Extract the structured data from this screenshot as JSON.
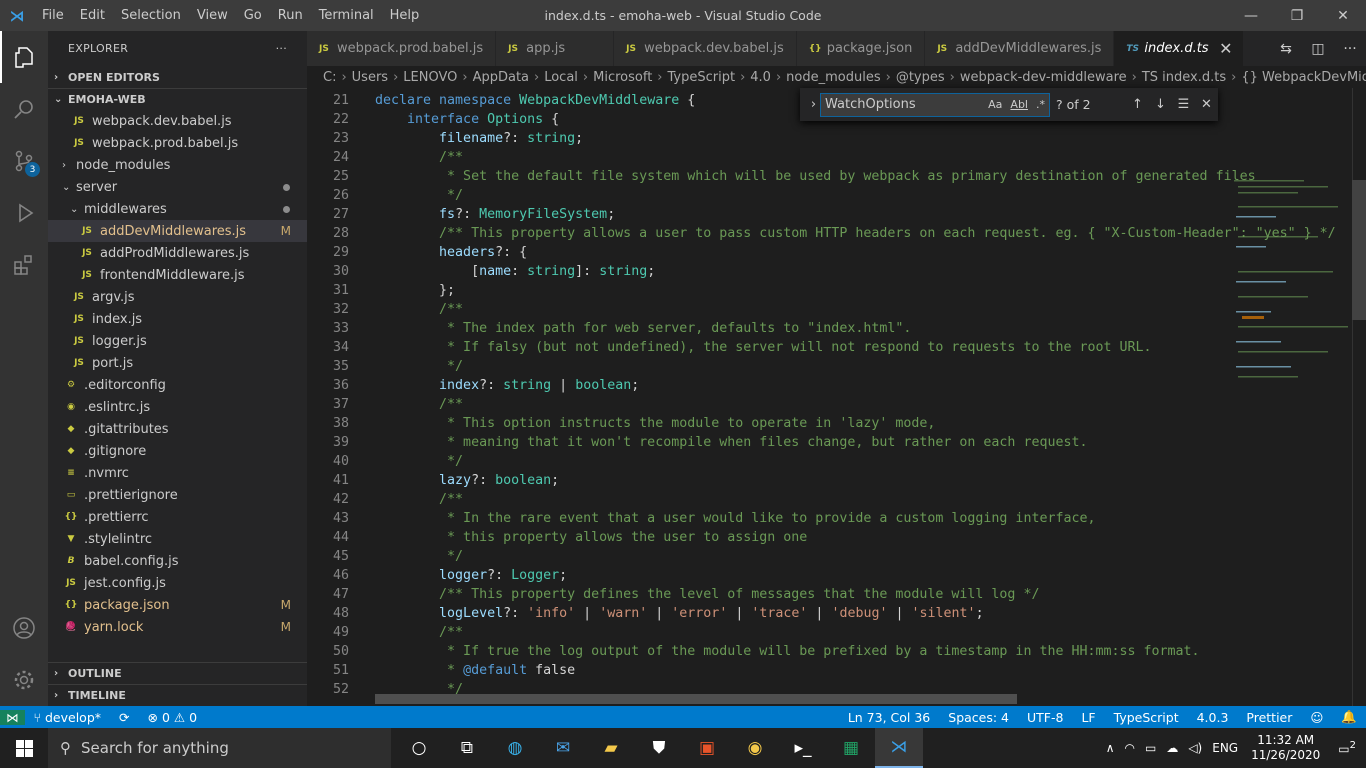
{
  "window": {
    "app_menu": [
      "File",
      "Edit",
      "Selection",
      "View",
      "Go",
      "Run",
      "Terminal",
      "Help"
    ],
    "title": "index.d.ts - emoha-web - Visual Studio Code"
  },
  "activity": {
    "scm_badge": "3"
  },
  "explorer": {
    "header": "EXPLORER",
    "more": "···",
    "open_editors": "OPEN EDITORS",
    "project": "EMOHA-WEB",
    "outline": "OUTLINE",
    "timeline": "TIMELINE",
    "items": [
      {
        "name": "webpack.dev.babel.js",
        "icon": "JS",
        "depth": 2,
        "kind": "file"
      },
      {
        "name": "webpack.prod.babel.js",
        "icon": "JS",
        "depth": 2,
        "kind": "file"
      },
      {
        "name": "node_modules",
        "icon": "",
        "depth": 1,
        "kind": "folder-closed"
      },
      {
        "name": "server",
        "icon": "",
        "depth": 1,
        "kind": "folder-open",
        "dot": true
      },
      {
        "name": "middlewares",
        "icon": "",
        "depth": 2,
        "kind": "folder-open",
        "dot": true
      },
      {
        "name": "addDevMiddlewares.js",
        "icon": "JS",
        "depth": 3,
        "kind": "file",
        "tag": "M",
        "selected": true
      },
      {
        "name": "addProdMiddlewares.js",
        "icon": "JS",
        "depth": 3,
        "kind": "file"
      },
      {
        "name": "frontendMiddleware.js",
        "icon": "JS",
        "depth": 3,
        "kind": "file"
      },
      {
        "name": "argv.js",
        "icon": "JS",
        "depth": 2,
        "kind": "file"
      },
      {
        "name": "index.js",
        "icon": "JS",
        "depth": 2,
        "kind": "file"
      },
      {
        "name": "logger.js",
        "icon": "JS",
        "depth": 2,
        "kind": "file"
      },
      {
        "name": "port.js",
        "icon": "JS",
        "depth": 2,
        "kind": "file"
      },
      {
        "name": ".editorconfig",
        "icon": "⚙",
        "depth": 1,
        "kind": "file"
      },
      {
        "name": ".eslintrc.js",
        "icon": "◉",
        "depth": 1,
        "kind": "file"
      },
      {
        "name": ".gitattributes",
        "icon": "◆",
        "depth": 1,
        "kind": "file"
      },
      {
        "name": ".gitignore",
        "icon": "◆",
        "depth": 1,
        "kind": "file"
      },
      {
        "name": ".nvmrc",
        "icon": "≡",
        "depth": 1,
        "kind": "file"
      },
      {
        "name": ".prettierignore",
        "icon": "▭",
        "depth": 1,
        "kind": "file"
      },
      {
        "name": ".prettierrc",
        "icon": "{}",
        "depth": 1,
        "kind": "file"
      },
      {
        "name": ".stylelintrc",
        "icon": "▼",
        "depth": 1,
        "kind": "file"
      },
      {
        "name": "babel.config.js",
        "icon": "𝘽",
        "depth": 1,
        "kind": "file"
      },
      {
        "name": "jest.config.js",
        "icon": "JS",
        "depth": 1,
        "kind": "file"
      },
      {
        "name": "package.json",
        "icon": "{}",
        "depth": 1,
        "kind": "file",
        "tag": "M"
      },
      {
        "name": "yarn.lock",
        "icon": "🧶",
        "depth": 1,
        "kind": "file",
        "tag": "M"
      }
    ]
  },
  "tabs": [
    {
      "label": "webpack.prod.babel.js",
      "icon": "JS"
    },
    {
      "label": "app.js",
      "icon": "JS"
    },
    {
      "label": "webpack.dev.babel.js",
      "icon": "JS"
    },
    {
      "label": "package.json",
      "icon": "{}"
    },
    {
      "label": "addDevMiddlewares.js",
      "icon": "JS"
    },
    {
      "label": "index.d.ts",
      "icon": "TS",
      "active": true
    }
  ],
  "breadcrumbs": [
    "C:",
    "Users",
    "LENOVO",
    "AppData",
    "Local",
    "Microsoft",
    "TypeScript",
    "4.0",
    "node_modules",
    "@types",
    "webpack-dev-middleware",
    "TS index.d.ts",
    "{} WebpackDevMiddleware"
  ],
  "find": {
    "value": "WatchOptions",
    "options": [
      "Aa",
      "Abl",
      ".*"
    ],
    "count": "? of 2"
  },
  "code_lines": [
    {
      "n": "21",
      "t": [
        [
          "kw",
          "declare namespace "
        ],
        [
          "ty",
          "WebpackDevMiddleware"
        ],
        [
          "pu",
          " {"
        ]
      ]
    },
    {
      "n": "22",
      "t": [
        [
          "kw",
          "    interface "
        ],
        [
          "ty",
          "Options"
        ],
        [
          "pu",
          " {"
        ]
      ]
    },
    {
      "n": "23",
      "t": [
        [
          "pr",
          "        filename"
        ],
        [
          "pu",
          "?: "
        ],
        [
          "ty",
          "string"
        ],
        [
          "pu",
          ";"
        ]
      ]
    },
    {
      "n": "24",
      "t": [
        [
          "cm",
          "        /**"
        ]
      ]
    },
    {
      "n": "25",
      "t": [
        [
          "cm",
          "         * Set the default file system which will be used by webpack as primary destination of generated files"
        ]
      ]
    },
    {
      "n": "26",
      "t": [
        [
          "cm",
          "         */"
        ]
      ]
    },
    {
      "n": "27",
      "t": [
        [
          "pr",
          "        fs"
        ],
        [
          "pu",
          "?: "
        ],
        [
          "ty",
          "MemoryFileSystem"
        ],
        [
          "pu",
          ";"
        ]
      ]
    },
    {
      "n": "28",
      "t": [
        [
          "cm",
          "        /** This property allows a user to pass custom HTTP headers on each request. eg. { \"X-Custom-Header\": \"yes\" } */"
        ]
      ]
    },
    {
      "n": "29",
      "t": [
        [
          "pr",
          "        headers"
        ],
        [
          "pu",
          "?: {"
        ]
      ]
    },
    {
      "n": "30",
      "t": [
        [
          "pu",
          "            ["
        ],
        [
          "pr",
          "name"
        ],
        [
          "pu",
          ": "
        ],
        [
          "ty",
          "string"
        ],
        [
          "pu",
          "]: "
        ],
        [
          "ty",
          "string"
        ],
        [
          "pu",
          ";"
        ]
      ]
    },
    {
      "n": "31",
      "t": [
        [
          "pu",
          "        };"
        ]
      ]
    },
    {
      "n": "32",
      "t": [
        [
          "cm",
          "        /**"
        ]
      ]
    },
    {
      "n": "33",
      "t": [
        [
          "cm",
          "         * The index path for web server, defaults to \"index.html\"."
        ]
      ]
    },
    {
      "n": "34",
      "t": [
        [
          "cm",
          "         * If falsy (but not undefined), the server will not respond to requests to the root URL."
        ]
      ]
    },
    {
      "n": "35",
      "t": [
        [
          "cm",
          "         */"
        ]
      ]
    },
    {
      "n": "36",
      "t": [
        [
          "pr",
          "        index"
        ],
        [
          "pu",
          "?: "
        ],
        [
          "ty",
          "string"
        ],
        [
          "pu",
          " | "
        ],
        [
          "ty",
          "boolean"
        ],
        [
          "pu",
          ";"
        ]
      ]
    },
    {
      "n": "37",
      "t": [
        [
          "cm",
          "        /**"
        ]
      ]
    },
    {
      "n": "38",
      "t": [
        [
          "cm",
          "         * This option instructs the module to operate in 'lazy' mode,"
        ]
      ]
    },
    {
      "n": "39",
      "t": [
        [
          "cm",
          "         * meaning that it won't recompile when files change, but rather on each request."
        ]
      ]
    },
    {
      "n": "40",
      "t": [
        [
          "cm",
          "         */"
        ]
      ]
    },
    {
      "n": "41",
      "t": [
        [
          "pr",
          "        lazy"
        ],
        [
          "pu",
          "?: "
        ],
        [
          "ty",
          "boolean"
        ],
        [
          "pu",
          ";"
        ]
      ]
    },
    {
      "n": "42",
      "t": [
        [
          "cm",
          "        /**"
        ]
      ]
    },
    {
      "n": "43",
      "t": [
        [
          "cm",
          "         * In the rare event that a user would like to provide a custom logging interface,"
        ]
      ]
    },
    {
      "n": "44",
      "t": [
        [
          "cm",
          "         * this property allows the user to assign one"
        ]
      ]
    },
    {
      "n": "45",
      "t": [
        [
          "cm",
          "         */"
        ]
      ]
    },
    {
      "n": "46",
      "t": [
        [
          "pr",
          "        logger"
        ],
        [
          "pu",
          "?: "
        ],
        [
          "ty",
          "Logger"
        ],
        [
          "pu",
          ";"
        ]
      ]
    },
    {
      "n": "47",
      "t": [
        [
          "cm",
          "        /** This property defines the level of messages that the module will log */"
        ]
      ]
    },
    {
      "n": "48",
      "t": [
        [
          "pr",
          "        logLevel"
        ],
        [
          "pu",
          "?: "
        ],
        [
          "st",
          "'info'"
        ],
        [
          "pu",
          " | "
        ],
        [
          "st",
          "'warn'"
        ],
        [
          "pu",
          " | "
        ],
        [
          "st",
          "'error'"
        ],
        [
          "pu",
          " | "
        ],
        [
          "st",
          "'trace'"
        ],
        [
          "pu",
          " | "
        ],
        [
          "st",
          "'debug'"
        ],
        [
          "pu",
          " | "
        ],
        [
          "st",
          "'silent'"
        ],
        [
          "pu",
          ";"
        ]
      ]
    },
    {
      "n": "49",
      "t": [
        [
          "cm",
          "        /**"
        ]
      ]
    },
    {
      "n": "50",
      "t": [
        [
          "cm",
          "         * If true the log output of the module will be prefixed by a timestamp in the HH:mm:ss format."
        ]
      ]
    },
    {
      "n": "51",
      "t": [
        [
          "cm",
          "         * "
        ],
        [
          "kw",
          "@default"
        ],
        [
          "pu",
          " false"
        ]
      ]
    },
    {
      "n": "52",
      "t": [
        [
          "cm",
          "         */"
        ]
      ]
    }
  ],
  "status": {
    "branch": "develop*",
    "problems": "0",
    "warnings": "0",
    "position": "Ln 73, Col 36",
    "spaces": "Spaces: 4",
    "encoding": "UTF-8",
    "eol": "LF",
    "language": "TypeScript",
    "ts_version": "4.0.3",
    "formatter": "Prettier"
  },
  "taskbar": {
    "search_placeholder": "Search for anything",
    "lang": "ENG",
    "time": "11:32 AM",
    "date": "11/26/2020",
    "notifications": "2"
  },
  "colors": {
    "accent": "#007acc",
    "title_bar": "#3c3c3c",
    "editor_bg": "#1e1e1e"
  }
}
